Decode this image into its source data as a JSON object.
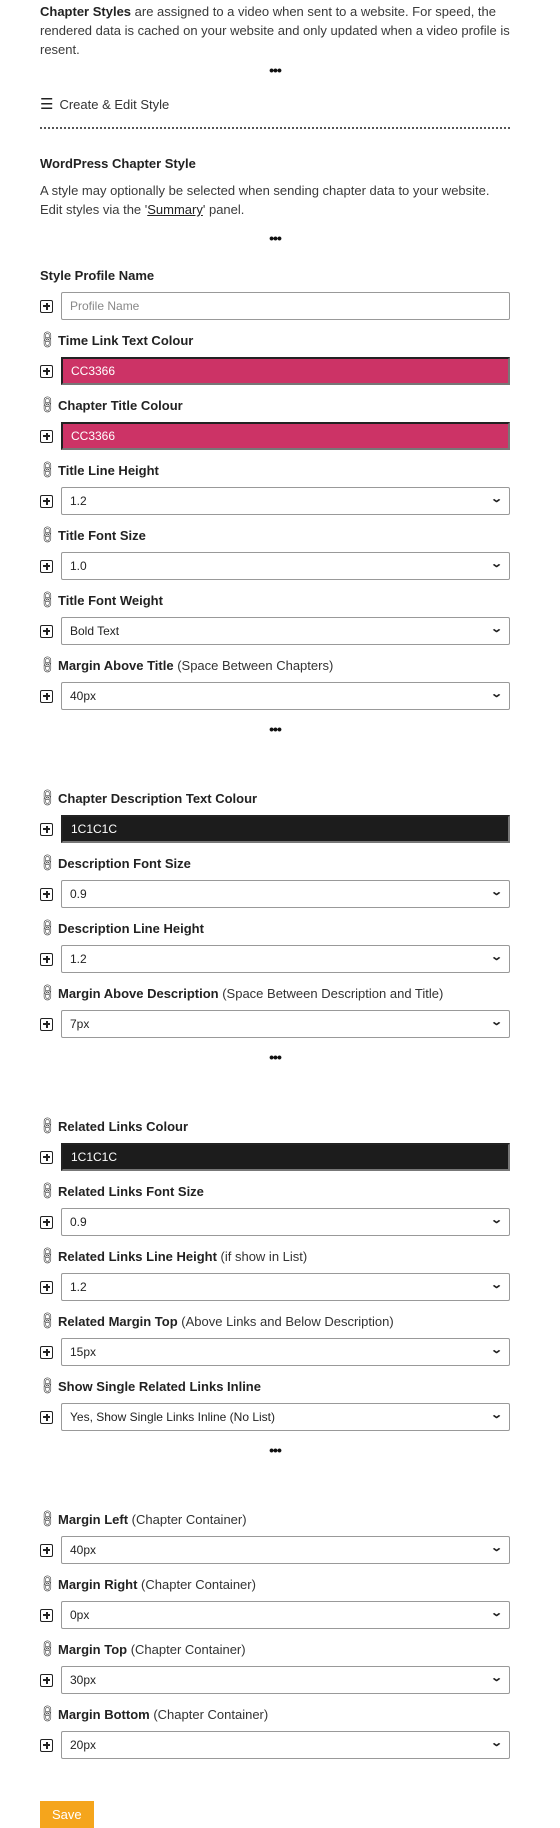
{
  "intro": {
    "bold_lead": "Chapter Styles",
    "line1_rest": " are assigned to a video when sent to a website. For speed, the",
    "line2": "rendered data is cached on your website and only updated when a video profile is resent."
  },
  "menu": {
    "icon": "hamburger-icon",
    "label": "Create & Edit Style"
  },
  "section": {
    "title": "WordPress Chapter Style",
    "desc_before": "A style may optionally be selected when sending chapter data to your website. Edit styles via the '",
    "desc_link": "Summary",
    "desc_after": "' panel."
  },
  "dots": "•••",
  "groups": [
    [
      {
        "label": "Style Profile Name",
        "note": "",
        "type": "text",
        "placeholder": "Profile Name",
        "value": "",
        "link": false
      },
      {
        "label": "Time Link Text Colour",
        "note": "",
        "type": "color",
        "value": "CC3366",
        "color": "#cc3366",
        "link": true
      },
      {
        "label": "Chapter Title Colour",
        "note": "",
        "type": "color",
        "value": "CC3366",
        "color": "#cc3366",
        "link": true
      },
      {
        "label": "Title Line Height",
        "note": "",
        "type": "select",
        "value": "1.2",
        "link": true
      },
      {
        "label": "Title Font Size",
        "note": "",
        "type": "select",
        "value": "1.0",
        "link": true
      },
      {
        "label": "Title Font Weight",
        "note": "",
        "type": "select",
        "value": "Bold Text",
        "link": true
      },
      {
        "label": "Margin Above Title",
        "note": " (Space Between Chapters)",
        "type": "select",
        "value": "40px",
        "link": true
      }
    ],
    [
      {
        "label": "Chapter Description Text Colour",
        "note": "",
        "type": "color",
        "value": "1C1C1C",
        "color": "#1c1c1c",
        "link": true
      },
      {
        "label": "Description Font Size",
        "note": "",
        "type": "select",
        "value": "0.9",
        "link": true
      },
      {
        "label": "Description Line Height",
        "note": "",
        "type": "select",
        "value": "1.2",
        "link": true
      },
      {
        "label": "Margin Above Description",
        "note": " (Space Between Description and Title)",
        "type": "select",
        "value": "7px",
        "link": true
      }
    ],
    [
      {
        "label": "Related Links Colour",
        "note": "",
        "type": "color",
        "value": "1C1C1C",
        "color": "#1c1c1c",
        "link": true
      },
      {
        "label": "Related Links Font Size",
        "note": "",
        "type": "select",
        "value": "0.9",
        "link": true
      },
      {
        "label": "Related Links Line Height",
        "note": " (if show in List)",
        "type": "select",
        "value": "1.2",
        "link": true
      },
      {
        "label": "Related Margin Top",
        "note": " (Above Links and Below Description)",
        "type": "select",
        "value": "15px",
        "link": true
      },
      {
        "label": "Show Single Related Links Inline",
        "note": "",
        "type": "select",
        "value": "Yes, Show Single Links Inline (No List)",
        "link": true
      }
    ],
    [
      {
        "label": "Margin Left",
        "note": " (Chapter Container)",
        "type": "select",
        "value": "40px",
        "link": true
      },
      {
        "label": "Margin Right",
        "note": " (Chapter Container)",
        "type": "select",
        "value": "0px",
        "link": true
      },
      {
        "label": "Margin Top",
        "note": " (Chapter Container)",
        "type": "select",
        "value": "30px",
        "link": true
      },
      {
        "label": "Margin Bottom",
        "note": " (Chapter Container)",
        "type": "select",
        "value": "20px",
        "link": true
      }
    ]
  ],
  "save_label": "Save"
}
